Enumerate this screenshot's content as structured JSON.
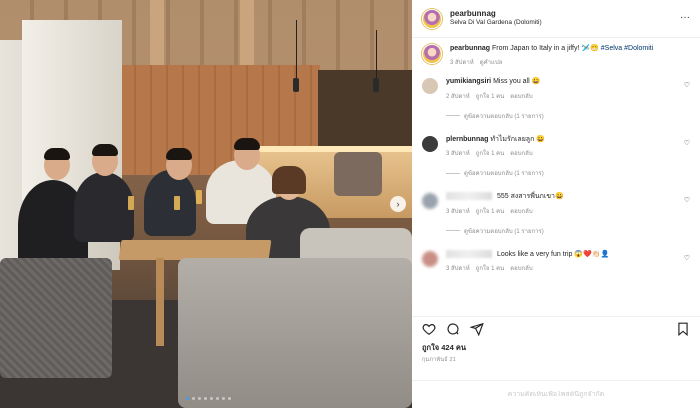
{
  "post": {
    "username": "pearbunnag",
    "location": "Selva Di Val Gardena (Dolomiti)"
  },
  "caption": {
    "username": "pearbunnag",
    "text": "From Japan to Italy in a jiffy! 🛩️😁",
    "hashtag1": "#Selva",
    "hashtag2": "#Dolomiti",
    "time": "3 สัปดาห์",
    "reply": "ดูคำแปล"
  },
  "comments": [
    {
      "username": "yumikiangsiri",
      "text": "Miss you all 😀",
      "time": "2 สัปดาห์",
      "likes": "ถูกใจ 1 คน",
      "reply": "ตอบกลับ",
      "replies": "ดูข้อความตอบกลับ (1 รายการ)",
      "avatar_color": "#d9c7b5"
    },
    {
      "username": "plernbunnag",
      "text": "ทำไมรักเลยลูก 😀",
      "time": "3 สัปดาห์",
      "likes": "ถูกใจ 1 คน",
      "reply": "ตอบกลับ",
      "replies": "ดูข้อความตอบกลับ (1 รายการ)",
      "avatar_color": "#3b3b3b"
    },
    {
      "username": "",
      "text": "555 สงสารพี่นกเขา😀",
      "time": "3 สัปดาห์",
      "likes": "ถูกใจ 1 คน",
      "reply": "ตอบกลับ",
      "replies": "ดูข้อความตอบกลับ (1 รายการ)",
      "avatar_color": "#9aa3ad"
    },
    {
      "username": "",
      "text": "Looks like a very fun trip 😱❤️👏🏻👤",
      "time": "3 สัปดาห์",
      "likes": "ถูกใจ 1 คน",
      "reply": "ตอบกลับ",
      "replies": "",
      "avatar_color": "#c98f86"
    }
  ],
  "likes_text": "ถูกใจ 424 คน",
  "date_text": "กุมภาพันธ์ 21",
  "add_comment_placeholder": "ความคิดเห็นเพื่อโพสต์นี้ถูกจำกัด",
  "icons": {
    "more": "more-icon",
    "heart": "heart-icon",
    "comment": "comment-icon",
    "share": "share-icon",
    "save": "save-icon",
    "next": "chevron-right-icon"
  },
  "carousel": {
    "count": 8,
    "active_index": 0
  },
  "colors": {
    "link": "#00376b",
    "muted": "#8e8e8e",
    "active_dot": "#4a9bf0"
  }
}
